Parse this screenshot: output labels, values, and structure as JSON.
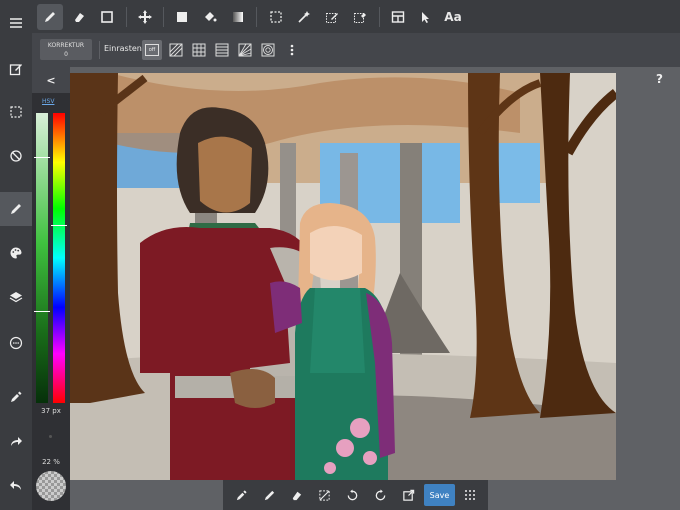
{
  "top_toolbar": {
    "tools": [
      "pen-icon",
      "eraser-icon",
      "square-outline-icon",
      "move-icon",
      "fill-square-icon",
      "bucket-icon",
      "gradient-icon",
      "select-rect-icon",
      "magic-wand-icon",
      "select-pen-icon",
      "select-eraser-icon",
      "panel-icon",
      "pointer-icon"
    ],
    "text_tool_label": "Aa"
  },
  "sub_toolbar": {
    "correction_title": "KORREKTUR",
    "correction_value": "0",
    "snap_label": "Einrasten",
    "snap_off_label": "off"
  },
  "left_sidebar": {
    "items": [
      "menu-icon",
      "edit-icon",
      "selection-icon",
      "transform-icon",
      "brush-icon",
      "palette-icon",
      "layers-icon",
      "materials-icon",
      "eyedropper-icon",
      "redo-icon",
      "undo-icon"
    ]
  },
  "color_panel": {
    "mode_label": "HSV",
    "brush_size": "37 px",
    "opacity": "22 %",
    "colors": {
      "primary": "#2e7a2e",
      "hue": "#00ff00"
    }
  },
  "bottom_toolbar": {
    "save_label": "Save"
  },
  "help_label": "?",
  "collapse_label": "<"
}
